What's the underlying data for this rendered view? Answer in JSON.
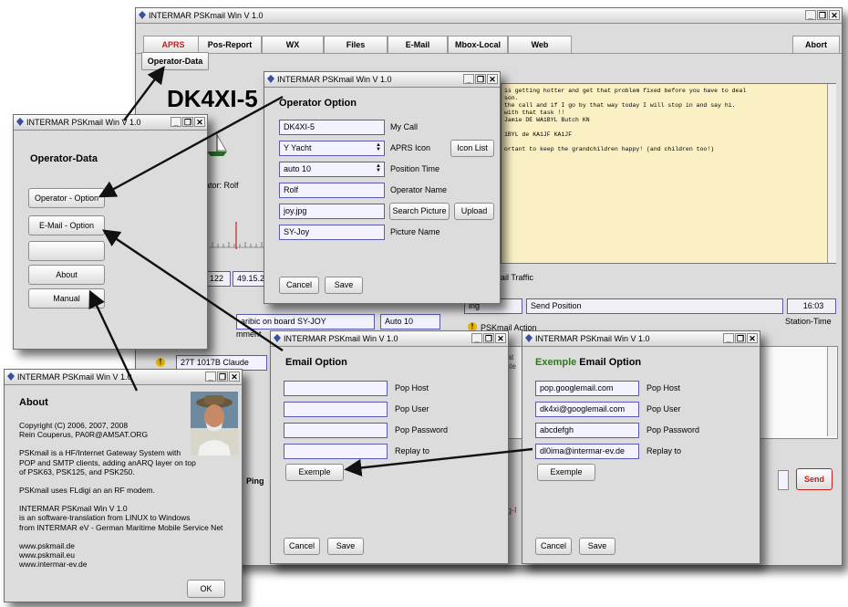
{
  "main": {
    "title": "INTERMAR PSKmail Win V 1.0",
    "tabs": [
      "APRS",
      "Pos-Report",
      "WX",
      "Files",
      "E-Mail",
      "Mbox-Local",
      "Web"
    ],
    "abort": "Abort",
    "operator_data_btn": "Operator-Data",
    "callsign": "DK4XI-5",
    "operator_partial": "ator: Rolf",
    "messages": [
      "is getting hotter and get that problem fixed before you have to deal",
      "son.",
      "the call and if I go by that way today I will stop in and say hi.",
      "with that task !!",
      "Jamie DE WA1BYL Butch KN",
      "",
      "1BYL de KA1JF KA1JF",
      "",
      "ortant to keep the grandchildren happy! (and children too!)"
    ],
    "mail_traffic": "ail Traffic",
    "ing": "ing",
    "send_position": "Send Position",
    "time": "16:03",
    "station_time": "Station-Time",
    "pskmail_action": "PSKmail Action",
    "lat_partial": "122",
    "lon_partial": "49.15.2",
    "onboard": "aribic on board SY-JOY",
    "auto10": "Auto 10",
    "comment": "mment",
    "list_item": "27T 1017B Claude",
    "ping": "Ping",
    "send": "Send",
    "stat": "Stat",
    "list": "Liste",
    "ng_partial": "ng-I"
  },
  "operator_data": {
    "title": "INTERMAR PSKmail Win V 1.0",
    "heading": "Operator-Data",
    "buttons": [
      "Operator - Option",
      "E-Mail - Option",
      "",
      "About",
      "Manual"
    ]
  },
  "operator_option": {
    "title": "INTERMAR PSKmail Win V 1.0",
    "heading": "Operator Option",
    "rows": [
      {
        "value": "DK4XI-5",
        "label": "My Call"
      },
      {
        "value": "Y  Yacht",
        "label": "APRS Icon"
      },
      {
        "value": "auto 10",
        "label": "Position Time"
      },
      {
        "value": "Rolf",
        "label": "Operator Name"
      },
      {
        "value": "joy.jpg",
        "label": ""
      },
      {
        "value": "SY-Joy",
        "label": "Picture Name"
      }
    ],
    "icon_list": "Icon List",
    "search_picture": "Search Picture",
    "upload": "Upload",
    "cancel": "Cancel",
    "save": "Save"
  },
  "email_option": {
    "title": "INTERMAR PSKmail Win V 1.0",
    "heading": "Email Option",
    "rows": [
      {
        "value": "",
        "label": "Pop Host"
      },
      {
        "value": "",
        "label": "Pop User"
      },
      {
        "value": "",
        "label": "Pop Password"
      },
      {
        "value": "",
        "label": "Replay to"
      }
    ],
    "exemple": "Exemple",
    "cancel": "Cancel",
    "save": "Save"
  },
  "exemple_email": {
    "title": "INTERMAR PSKmail Win V 1.0",
    "heading_green": "Exemple",
    "heading_rest": " Email Option",
    "rows": [
      {
        "value": "pop.googlemail.com",
        "label": "Pop Host"
      },
      {
        "value": "dk4xi@googlemail.com",
        "label": "Pop User"
      },
      {
        "value": "abcdefgh",
        "label": "Pop Password"
      },
      {
        "value": "dl0ima@intermar-ev.de",
        "label": "Replay to"
      }
    ],
    "exemple": "Exemple",
    "cancel": "Cancel",
    "save": "Save"
  },
  "about": {
    "title": "INTERMAR PSKmail Win V 1.0",
    "heading": "About",
    "lines": [
      "Copyright (C) 2006, 2007, 2008",
      "Rein Couperus, PA0R@AMSAT.ORG",
      "",
      "PSKmail is a HF/Internet Gateway System with",
      "POP and SMTP clients, adding anARQ layer on top",
      "of PSK63, PSK125, and PSK250.",
      "",
      "PSKmail uses FLdigi an an RF modem.",
      "",
      "INTERMAR PSKmail Win V 1.0",
      "is an software-translation from LINUX to Windows",
      "from INTERMAR eV - German Maritime Mobile Service Net",
      "",
      "www.pskmail.de",
      "www.pskmail.eu",
      "www.intermar-ev.de"
    ],
    "ok": "OK"
  },
  "colors": {
    "accent_red": "#c0201c",
    "message_bg": "#fbf0c4",
    "field_border": "#5a5ab0",
    "green": "#2e7a1a"
  }
}
